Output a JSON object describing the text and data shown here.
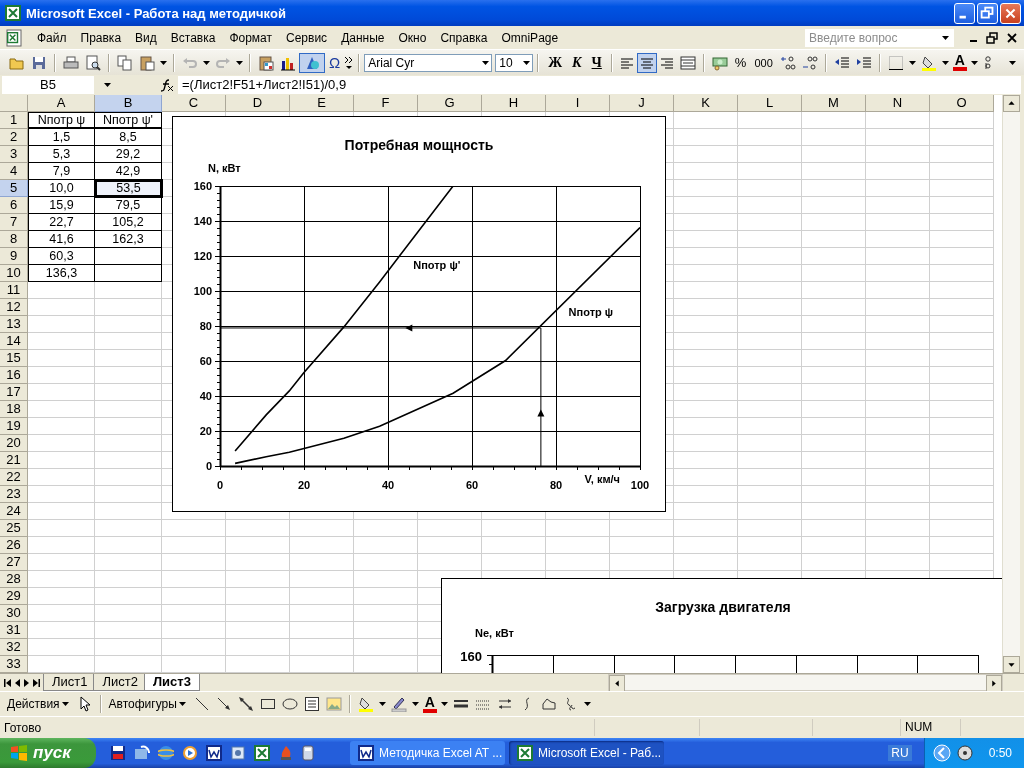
{
  "window": {
    "title": "Microsoft Excel - Работа над методичкой"
  },
  "menu_bar": {
    "items": [
      "Файл",
      "Правка",
      "Вид",
      "Вставка",
      "Формат",
      "Сервис",
      "Данные",
      "Окно",
      "Справка",
      "OmniPage"
    ],
    "help_field": {
      "placeholder": "Введите вопрос"
    }
  },
  "standard_toolbar": {
    "history_buttons": [
      {
        "disabled": true
      },
      {
        "disabled": true
      }
    ],
    "drawing_button": {
      "pressed": true
    },
    "symbol_button": "Ω"
  },
  "formatting_toolbar": {
    "font_name": "Arial Cyr",
    "font_size": "10",
    "style_buttons": [
      "Ж",
      "К",
      "Ч"
    ],
    "align_buttons": [
      {
        "selected": false
      },
      {
        "selected": true
      },
      {
        "selected": false
      }
    ],
    "percent_button": "%",
    "thousands_button": "000",
    "font_color_button": "A"
  },
  "formula_bar": {
    "name_box": "B5",
    "formula": "=(Лист2!F51+Лист2!I51)/0,9"
  },
  "sheet": {
    "columns": [
      {
        "label": "A",
        "selected": false
      },
      {
        "label": "B",
        "selected": true
      },
      {
        "label": "C",
        "selected": false
      },
      {
        "label": "D",
        "selected": false
      },
      {
        "label": "E",
        "selected": false
      },
      {
        "label": "F",
        "selected": false
      },
      {
        "label": "G",
        "selected": false
      },
      {
        "label": "H",
        "selected": false
      },
      {
        "label": "I",
        "selected": false
      },
      {
        "label": "J",
        "selected": false
      },
      {
        "label": "K",
        "selected": false
      },
      {
        "label": "L",
        "selected": false
      },
      {
        "label": "M",
        "selected": false
      },
      {
        "label": "N",
        "selected": false
      },
      {
        "label": "O",
        "selected": false
      }
    ],
    "rows": [
      {
        "label": "1",
        "selected": false,
        "cells": [
          {
            "text": "Nпотр ψ",
            "selected": false
          },
          {
            "text": "Nпотр ψ'",
            "selected": false
          }
        ]
      },
      {
        "label": "2",
        "selected": false,
        "cells": [
          {
            "text": "1,5",
            "selected": false
          },
          {
            "text": "8,5",
            "selected": false
          }
        ]
      },
      {
        "label": "3",
        "selected": false,
        "cells": [
          {
            "text": "5,3",
            "selected": false
          },
          {
            "text": "29,2",
            "selected": false
          }
        ]
      },
      {
        "label": "4",
        "selected": false,
        "cells": [
          {
            "text": "7,9",
            "selected": false
          },
          {
            "text": "42,9",
            "selected": false
          }
        ]
      },
      {
        "label": "5",
        "selected": true,
        "cells": [
          {
            "text": "10,0",
            "selected": false
          },
          {
            "text": "53,5",
            "selected": true
          }
        ]
      },
      {
        "label": "6",
        "selected": false,
        "cells": [
          {
            "text": "15,9",
            "selected": false
          },
          {
            "text": "79,5",
            "selected": false
          }
        ]
      },
      {
        "label": "7",
        "selected": false,
        "cells": [
          {
            "text": "22,7",
            "selected": false
          },
          {
            "text": "105,2",
            "selected": false
          }
        ]
      },
      {
        "label": "8",
        "selected": false,
        "cells": [
          {
            "text": "41,6",
            "selected": false
          },
          {
            "text": "162,3",
            "selected": false
          }
        ]
      },
      {
        "label": "9",
        "selected": false,
        "cells": [
          {
            "text": "60,3",
            "selected": false
          }
        ]
      },
      {
        "label": "10",
        "selected": false,
        "cells": [
          {
            "text": "136,3",
            "selected": false
          }
        ]
      },
      {
        "label": "11",
        "selected": false
      },
      {
        "label": "12",
        "selected": false
      },
      {
        "label": "13",
        "selected": false
      },
      {
        "label": "14",
        "selected": false
      },
      {
        "label": "15",
        "selected": false
      },
      {
        "label": "16",
        "selected": false
      },
      {
        "label": "17",
        "selected": false
      },
      {
        "label": "18",
        "selected": false
      },
      {
        "label": "19",
        "selected": false
      },
      {
        "label": "20",
        "selected": false
      },
      {
        "label": "21",
        "selected": false
      },
      {
        "label": "22",
        "selected": false
      },
      {
        "label": "23",
        "selected": false
      },
      {
        "label": "24",
        "selected": false
      },
      {
        "label": "25",
        "selected": false
      },
      {
        "label": "26",
        "selected": false
      },
      {
        "label": "27",
        "selected": false
      },
      {
        "label": "28",
        "selected": false
      },
      {
        "label": "29",
        "selected": false
      },
      {
        "label": "30",
        "selected": false
      },
      {
        "label": "31",
        "selected": false
      },
      {
        "label": "32",
        "selected": false
      },
      {
        "label": "33",
        "selected": false
      }
    ]
  },
  "chart": {
    "chart_data": {
      "type": "line",
      "title": "Потребная мощность",
      "xlabel": "V, км/ч",
      "ylabel": "N, кВт",
      "x": [
        3.6,
        11,
        16.5,
        20,
        29.5,
        38,
        55.5,
        68,
        100
      ],
      "series": [
        {
          "name": "Nпотр ψ",
          "color": "#000000",
          "values": [
            1.5,
            5.3,
            7.9,
            10.0,
            15.9,
            22.7,
            41.6,
            60.3,
            136.3
          ]
        },
        {
          "name": "Nпотр ψ'",
          "color": "#000000",
          "values": [
            8.5,
            29.2,
            42.9,
            53.5,
            79.5,
            105.2,
            160,
            null,
            null
          ]
        }
      ],
      "xlim": [
        0,
        100
      ],
      "ylim": [
        0,
        160
      ],
      "xticks": [
        0,
        20,
        40,
        60,
        80,
        100
      ],
      "yticks": [
        0,
        20,
        40,
        60,
        80,
        100,
        120,
        140,
        160
      ],
      "grid": true
    }
  },
  "chart_2": {
    "title": "Загрузка двигателя",
    "y_axis_title": "Ne, кВт",
    "y_tick": "160"
  },
  "sheet_tabs": [
    {
      "label": "Лист1",
      "selected": false
    },
    {
      "label": "Лист2",
      "selected": false
    },
    {
      "label": "Лист3",
      "selected": true
    }
  ],
  "drawing_toolbar": {
    "actions_menu": "Действия",
    "autoshapes_menu": "Автофигуры",
    "font_color_button": "A"
  },
  "status_bar": {
    "status": "Готово",
    "indicator": "NUM"
  },
  "taskbar": {
    "start": "пуск",
    "tasks": [
      {
        "label": "Методичка Excel AT ...",
        "selected": false
      },
      {
        "label": "Microsoft Excel - Раб...",
        "selected": true
      }
    ],
    "language": "RU",
    "clock": "0:50"
  }
}
